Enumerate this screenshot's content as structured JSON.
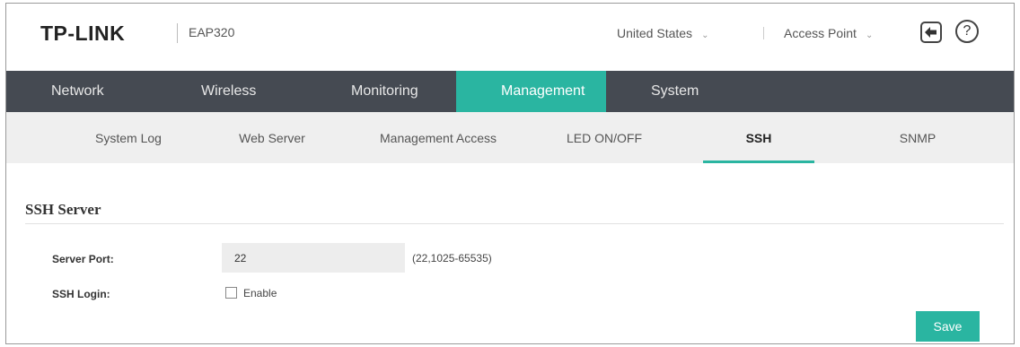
{
  "header": {
    "brand": "TP-LINK",
    "model": "EAP320",
    "region": "United States",
    "mode": "Access Point"
  },
  "main_nav": [
    "Network",
    "Wireless",
    "Monitoring",
    "Management",
    "System"
  ],
  "main_nav_active": "Management",
  "sub_nav": [
    "System Log",
    "Web Server",
    "Management Access",
    "LED ON/OFF",
    "SSH",
    "SNMP"
  ],
  "sub_nav_active": "SSH",
  "section": {
    "title": "SSH Server",
    "server_port_label": "Server Port:",
    "server_port_value": "22",
    "server_port_range": "(22,1025-65535)",
    "ssh_login_label": "SSH Login:",
    "enable_label": "Enable",
    "enable_checked": false
  },
  "save_label": "Save",
  "colors": {
    "accent": "#2ab5a1",
    "nav_bg": "#454a52",
    "subnav_bg": "#efefef"
  }
}
